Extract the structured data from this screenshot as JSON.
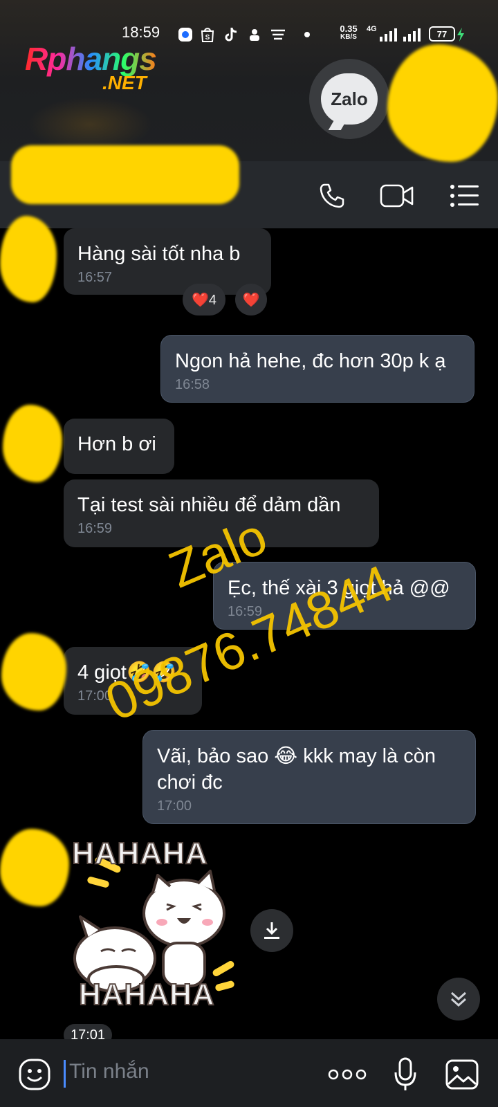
{
  "status_bar": {
    "time": "18:59",
    "net_speed_value": "0.35",
    "net_speed_unit": "KB/S",
    "network_type": "4G",
    "battery": "77"
  },
  "watermark_logo": {
    "main": "Rphangs",
    "sub": ".NET"
  },
  "app_badge": {
    "label": "Zalo"
  },
  "overlay_watermark": {
    "line1": "Zalo",
    "line2": "09876.74844"
  },
  "messages": [
    {
      "direction": "received",
      "text": "Hàng sài tốt nha b",
      "time": "16:57"
    },
    {
      "direction": "sent",
      "text": "Ngon hả hehe, đc hơn 30p k ạ",
      "time": "16:58"
    },
    {
      "direction": "received",
      "text": "Hơn b ơi",
      "time": ""
    },
    {
      "direction": "received",
      "text": "Tại test sài nhiều để dảm dần",
      "time": "16:59"
    },
    {
      "direction": "sent",
      "text": "Ẹc, thế xài 3 giọt hả @@",
      "time": "16:59"
    },
    {
      "direction": "received",
      "text": "4 giọt🤣🤣",
      "time": "17:00"
    },
    {
      "direction": "sent",
      "text": "Vãi, bảo sao 😂 kkk may là còn chơi đc",
      "time": "17:00"
    }
  ],
  "reactions": {
    "heart_count": "❤️4",
    "heart_button": "❤️"
  },
  "sticker": {
    "top_text": "HAHAHA",
    "bottom_text": "HAHAHA",
    "time": "17:01"
  },
  "input": {
    "placeholder": "Tin nhắn"
  },
  "colors": {
    "background": "#000000",
    "received_bubble": "#26282b",
    "sent_bubble": "#373f4c",
    "timestamp": "#7f8793",
    "watermark": "#f5c400",
    "redaction": "#ffd400"
  }
}
